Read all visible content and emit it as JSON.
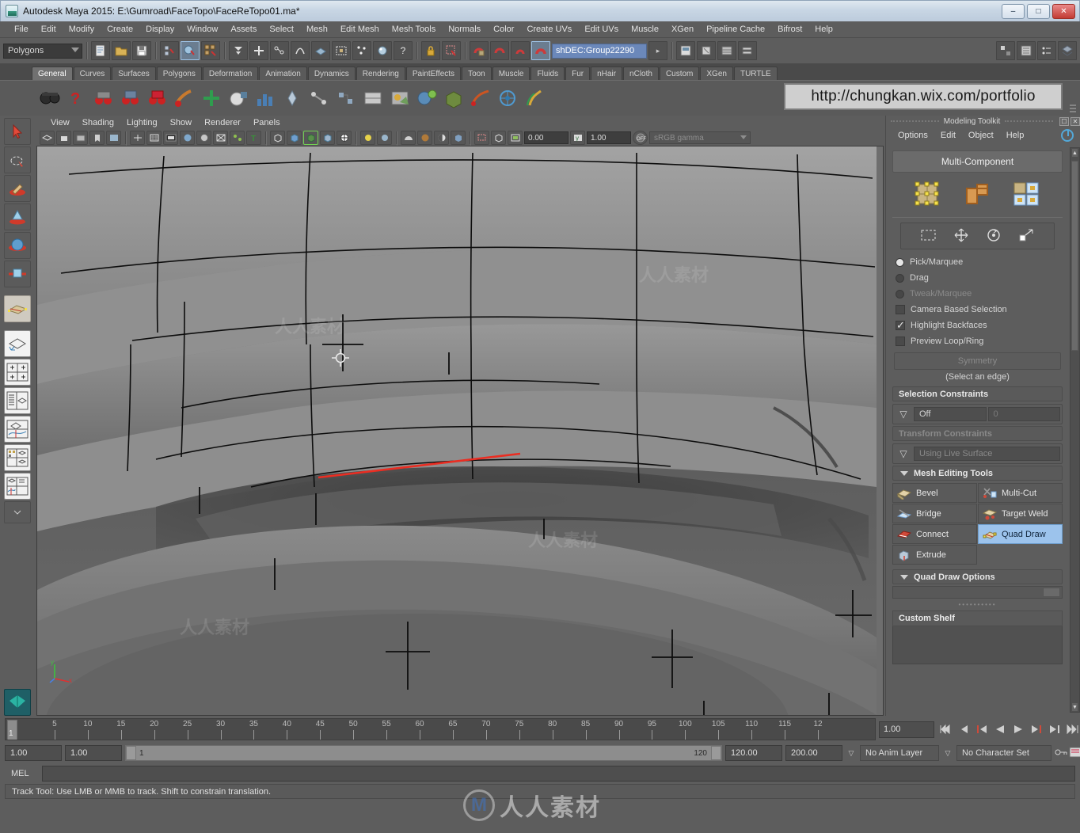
{
  "window": {
    "title": "Autodesk Maya 2015: E:\\Gumroad\\FaceTopo\\FaceReTopo01.ma*",
    "minimize": "–",
    "maximize": "□",
    "close": "✕"
  },
  "menubar": [
    "File",
    "Edit",
    "Modify",
    "Create",
    "Display",
    "Window",
    "Assets",
    "Select",
    "Mesh",
    "Edit Mesh",
    "Mesh Tools",
    "Normals",
    "Color",
    "Create UVs",
    "Edit UVs",
    "Muscle",
    "XGen",
    "Pipeline Cache",
    "Bifrost",
    "Help"
  ],
  "statusline": {
    "mode": "Polygons",
    "selection_field": "shDEC:Group22290"
  },
  "shelf": {
    "tabs": [
      "General",
      "Curves",
      "Surfaces",
      "Polygons",
      "Deformation",
      "Animation",
      "Dynamics",
      "Rendering",
      "PaintEffects",
      "Toon",
      "Muscle",
      "Fluids",
      "Fur",
      "nHair",
      "nCloth",
      "Custom",
      "XGen",
      "TURTLE"
    ],
    "active_tab": "General",
    "url_overlay": "http://chungkan.wix.com/portfolio"
  },
  "viewport": {
    "menus": [
      "View",
      "Shading",
      "Lighting",
      "Show",
      "Renderer",
      "Panels"
    ],
    "exposure": "0.00",
    "gamma": "1.00",
    "color_management": "sRGB gamma",
    "axis_x": "x",
    "axis_y": "y"
  },
  "modeling_toolkit": {
    "title": "Modeling Toolkit",
    "menus": [
      "Options",
      "Edit",
      "Object",
      "Help"
    ],
    "multi_component": "Multi-Component",
    "select_modes": [
      "Pick/Marquee",
      "Drag",
      "Tweak/Marquee"
    ],
    "selected_mode": "Pick/Marquee",
    "checkboxes": [
      {
        "label": "Camera Based Selection",
        "checked": false
      },
      {
        "label": "Highlight Backfaces",
        "checked": true
      },
      {
        "label": "Preview Loop/Ring",
        "checked": false
      }
    ],
    "symmetry_button": "Symmetry",
    "symmetry_note": "(Select an edge)",
    "selection_constraints": {
      "header": "Selection Constraints",
      "value": "Off",
      "amount": "0"
    },
    "transform_constraints": {
      "header": "Transform Constraints",
      "value": "Using Live Surface"
    },
    "mesh_editing_header": "Mesh Editing Tools",
    "mesh_tools": [
      "Bevel",
      "Multi-Cut",
      "Bridge",
      "Target Weld",
      "Connect",
      "Quad Draw",
      "Extrude"
    ],
    "active_tool": "Quad Draw",
    "quad_draw_options": "Quad Draw Options",
    "custom_shelf": "Custom Shelf"
  },
  "timeline": {
    "current_frame": "1",
    "labels": [
      "5",
      "10",
      "15",
      "20",
      "25",
      "30",
      "35",
      "40",
      "45",
      "50",
      "55",
      "60",
      "65",
      "70",
      "75",
      "80",
      "85",
      "90",
      "95",
      "100",
      "105",
      "110",
      "115",
      "12"
    ],
    "playback_speed": "1.00",
    "transport": [
      "⧏⧏",
      "⧏|",
      "|◀",
      "◀",
      "▶",
      "▶|",
      "|▶",
      "▶▶|"
    ]
  },
  "range": {
    "start_field": "1.00",
    "current_field": "1.00",
    "range_start": "1",
    "range_end": "120",
    "end_field": "120.00",
    "max_field": "200.00",
    "anim_layer": "No Anim Layer",
    "character_set": "No Character Set"
  },
  "command_line": {
    "label": "MEL",
    "value": "",
    "status": "Track Tool: Use LMB or MMB to track. Shift to constrain translation."
  },
  "watermark": {
    "logo_letter": "M",
    "logo_text": "人人素材"
  },
  "colors": {
    "accent_blue": "#9cc3ec",
    "selection_blue": "#6b88ba",
    "panel_gray": "#5d5d5d",
    "edge_red": "#e03030"
  }
}
